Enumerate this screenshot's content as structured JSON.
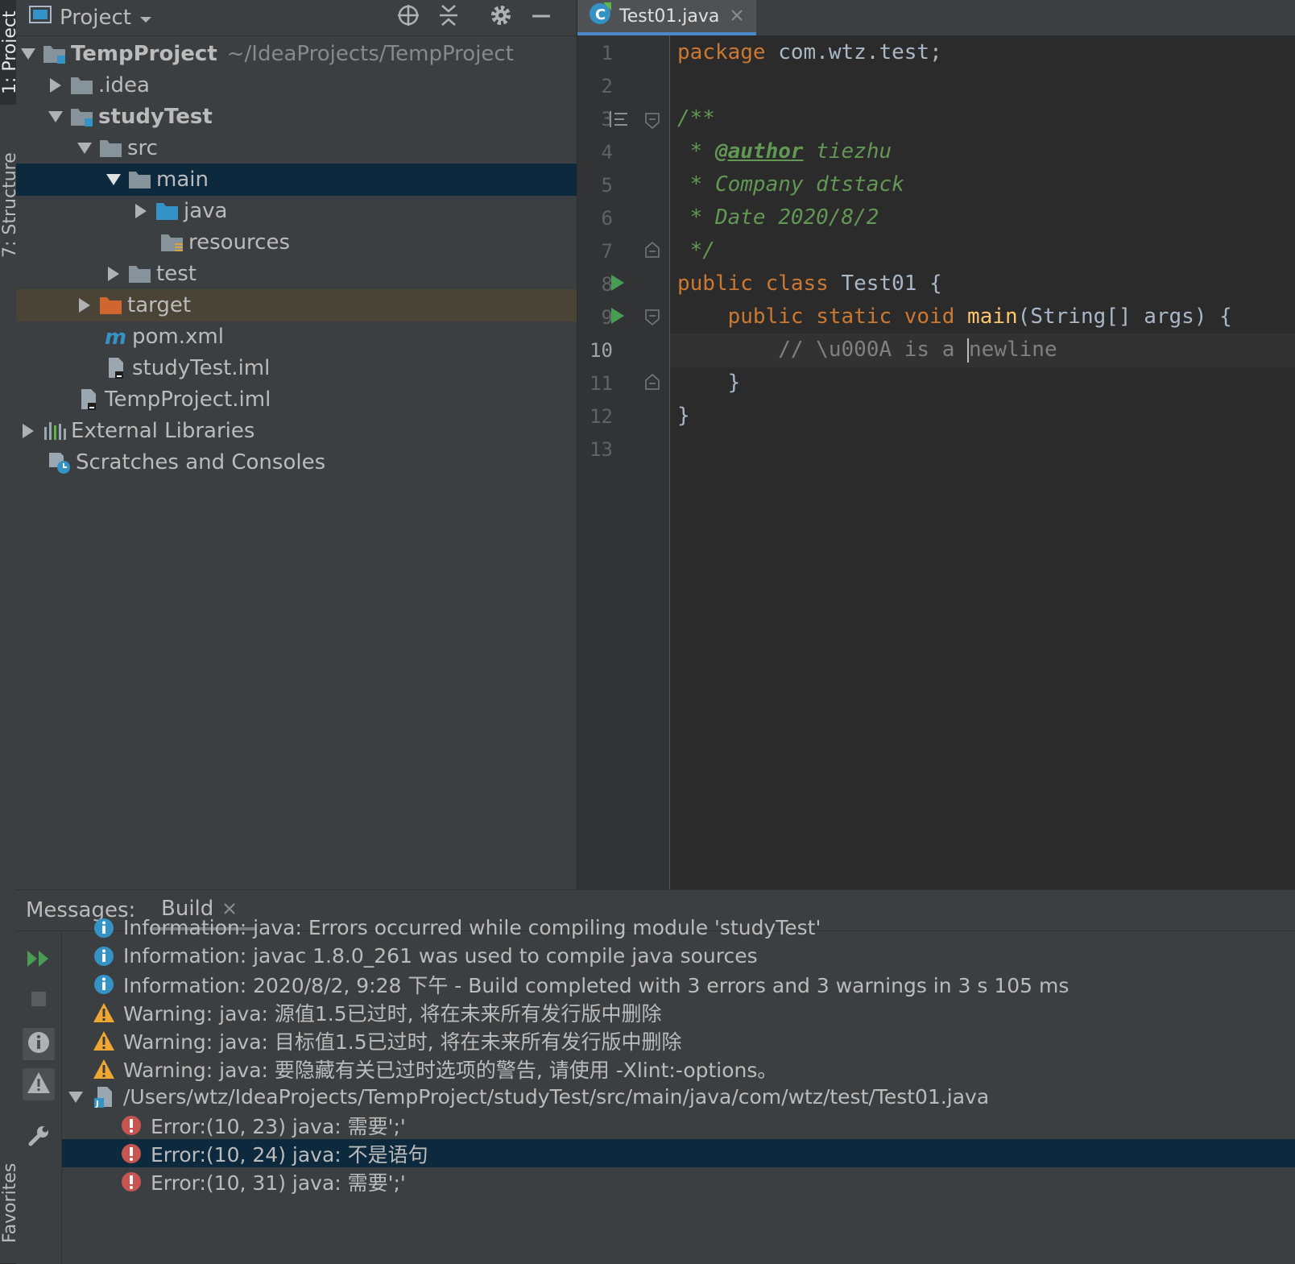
{
  "side_tabs": {
    "project": "1: Project",
    "structure": "7: Structure",
    "favorites": "Favorites"
  },
  "project_panel": {
    "title": "Project",
    "tree": [
      {
        "label": "TempProject",
        "extra": "~/IdeaProjects/TempProject",
        "icon": "module-folder-icon",
        "expanded": true
      },
      {
        "label": ".idea",
        "icon": "folder-icon",
        "expanded": false
      },
      {
        "label": "studyTest",
        "icon": "module-folder-icon",
        "expanded": true
      },
      {
        "label": "src",
        "icon": "folder-icon",
        "expanded": true
      },
      {
        "label": "main",
        "icon": "folder-icon",
        "expanded": true,
        "selected": true
      },
      {
        "label": "java",
        "icon": "source-folder-icon",
        "expanded": false
      },
      {
        "label": "resources",
        "icon": "resources-folder-icon"
      },
      {
        "label": "test",
        "icon": "folder-icon",
        "expanded": false
      },
      {
        "label": "target",
        "icon": "excluded-folder-icon",
        "expanded": false
      },
      {
        "label": "pom.xml",
        "icon": "maven-icon"
      },
      {
        "label": "studyTest.iml",
        "icon": "iml-file-icon"
      },
      {
        "label": "TempProject.iml",
        "icon": "iml-file-icon"
      },
      {
        "label": "External Libraries",
        "icon": "libraries-icon",
        "expanded": false
      },
      {
        "label": "Scratches and Consoles",
        "icon": "scratches-icon"
      }
    ]
  },
  "editor": {
    "tab_label": "Test01.java",
    "line_numbers": [
      "1",
      "2",
      "3",
      "4",
      "5",
      "6",
      "7",
      "8",
      "9",
      "10",
      "11",
      "12",
      "13"
    ],
    "current_line": "10",
    "code": {
      "l1_kw": "package",
      "l1_rest": " com.wtz.test;",
      "l3": "/**",
      "l4_star": " * ",
      "l4_tag": "@author",
      "l4_rest": " tiezhu",
      "l5": " * Company dtstack",
      "l6": " * Date 2020/8/2",
      "l7": " */",
      "l8_kw": "public class",
      "l8_rest": " Test01 {",
      "l9_indent": "    ",
      "l9_kw": "public static void",
      "l9_fn": " main",
      "l9_rest": "(String[] args) {",
      "l10_before": "        // \\u000A is a ",
      "l10_after": "newline",
      "l11": "    }",
      "l12": "}"
    }
  },
  "bottom_panel": {
    "title": "Messages:",
    "tab_label": "Build",
    "messages": [
      {
        "type": "info",
        "text": "Information: java: Errors occurred while compiling module 'studyTest'"
      },
      {
        "type": "info",
        "text": "Information: javac 1.8.0_261 was used to compile java sources"
      },
      {
        "type": "info",
        "text": "Information: 2020/8/2, 9:28 下午 - Build completed with 3 errors and 3 warnings in 3 s 105 ms"
      },
      {
        "type": "warning",
        "text": "Warning: java: 源值1.5已过时, 将在未来所有发行版中删除"
      },
      {
        "type": "warning",
        "text": "Warning: java: 目标值1.5已过时, 将在未来所有发行版中删除"
      },
      {
        "type": "warning",
        "text": "Warning: java: 要隐藏有关已过时选项的警告, 请使用 -Xlint:-options。"
      },
      {
        "type": "file",
        "text": "/Users/wtz/IdeaProjects/TempProject/studyTest/src/main/java/com/wtz/test/Test01.java"
      },
      {
        "type": "error",
        "text": "Error:(10, 23)  java: 需要';'"
      },
      {
        "type": "error",
        "text": "Error:(10, 24)  java: 不是语句",
        "selected": true
      },
      {
        "type": "error",
        "text": "Error:(10, 31)  java: 需要';'"
      }
    ]
  },
  "colors": {
    "selection": "#0d293e",
    "excluded": "#4a4437",
    "keyword": "#cc7832",
    "doc_comment": "#629755",
    "function": "#ffc66d",
    "run_gutter": "#499c54"
  }
}
